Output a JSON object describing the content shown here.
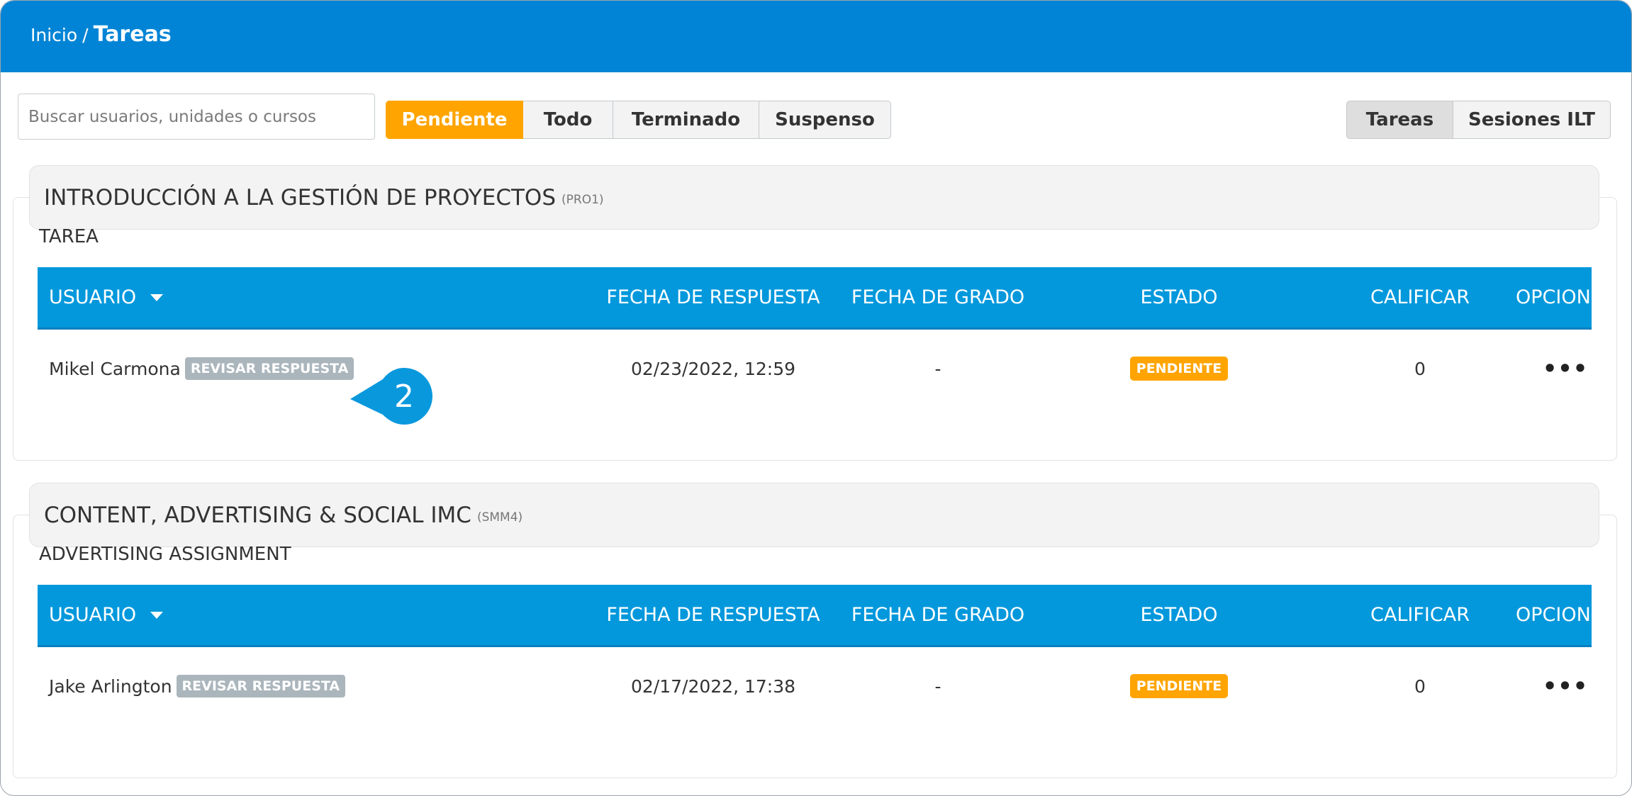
{
  "breadcrumb": {
    "home": "Inicio",
    "separator": "/",
    "current": "Tareas"
  },
  "search": {
    "placeholder": "Buscar usuarios, unidades o cursos",
    "value": ""
  },
  "status_filter": [
    {
      "label": "Pendiente",
      "active": true
    },
    {
      "label": "Todo",
      "active": false
    },
    {
      "label": "Terminado",
      "active": false
    },
    {
      "label": "Suspenso",
      "active": false
    }
  ],
  "view_toggle": [
    {
      "label": "Tareas",
      "active": true
    },
    {
      "label": "Sesiones ILT",
      "active": false
    }
  ],
  "table_headers": {
    "user": "USUARIO",
    "response_date": "FECHA DE RESPUESTA",
    "grade_date": "FECHA DE GRADO",
    "status": "ESTADO",
    "grade": "CALIFICAR",
    "options": "OPCIONES"
  },
  "courses": [
    {
      "title": "INTRODUCCIÓN A LA GESTIÓN DE PROYECTOS",
      "code": "(PRO1)",
      "assignment": "TAREA",
      "rows": [
        {
          "user": "Mikel Carmona",
          "review_label": "REVISAR RESPUESTA",
          "response_date": "02/23/2022, 12:59",
          "grade_date": "-",
          "status": "PENDIENTE",
          "grade": "0",
          "options": "•••"
        }
      ]
    },
    {
      "title": "CONTENT, ADVERTISING & SOCIAL IMC",
      "code": "(SMM4)",
      "assignment": "ADVERTISING ASSIGNMENT",
      "rows": [
        {
          "user": "Jake Arlington",
          "review_label": "REVISAR RESPUESTA",
          "response_date": "02/17/2022, 17:38",
          "grade_date": "-",
          "status": "PENDIENTE",
          "grade": "0",
          "options": "•••"
        }
      ]
    }
  ],
  "callout": {
    "number": "2"
  },
  "colors": {
    "topbar": "#0284d6",
    "table_header": "#0398dc",
    "accent_orange": "#ffa400",
    "review_badge": "#aab5bc",
    "callout": "#0a98dd"
  }
}
